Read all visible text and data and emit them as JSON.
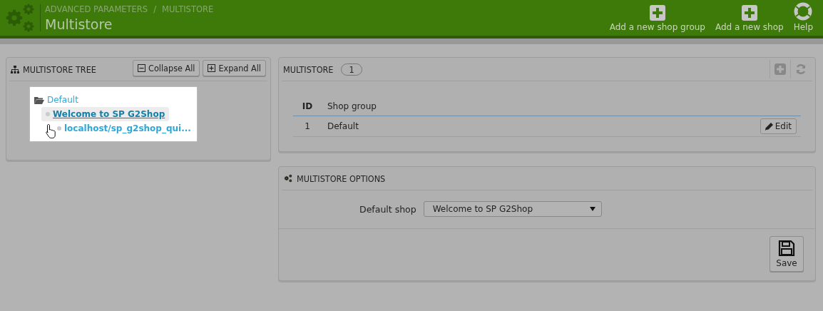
{
  "header": {
    "breadcrumb": [
      "ADVANCED PARAMETERS",
      "MULTISTORE"
    ],
    "breadcrumb_separator": "/",
    "title": "Multistore",
    "actions": [
      {
        "kind": "add",
        "label": "Add a new shop group"
      },
      {
        "kind": "add",
        "label": "Add a new shop"
      },
      {
        "kind": "help",
        "label": "Help"
      }
    ]
  },
  "tree_panel": {
    "title": "MULTISTORE TREE",
    "buttons": [
      {
        "kind": "collapse",
        "label": "Collapse All"
      },
      {
        "kind": "expand",
        "label": "Expand All"
      }
    ],
    "tree": [
      {
        "kind": "group",
        "label": "Default",
        "selected": false,
        "children": [
          {
            "kind": "shop",
            "label": "Welcome to SP G2Shop",
            "selected": true,
            "children": [
              {
                "kind": "url",
                "label": "localhost/sp_g2shop_qui...",
                "selected": false
              }
            ]
          }
        ]
      }
    ]
  },
  "multistore_panel": {
    "title": "MULTISTORE",
    "count": "1",
    "columns": [
      "ID",
      "Shop group"
    ],
    "rows": [
      {
        "id": "1",
        "shop_group": "Default",
        "action": "Edit"
      }
    ]
  },
  "options_panel": {
    "title": "MULTISTORE OPTIONS",
    "field_label": "Default shop",
    "field_value": "Welcome to SP G2Shop",
    "save": "Save"
  }
}
